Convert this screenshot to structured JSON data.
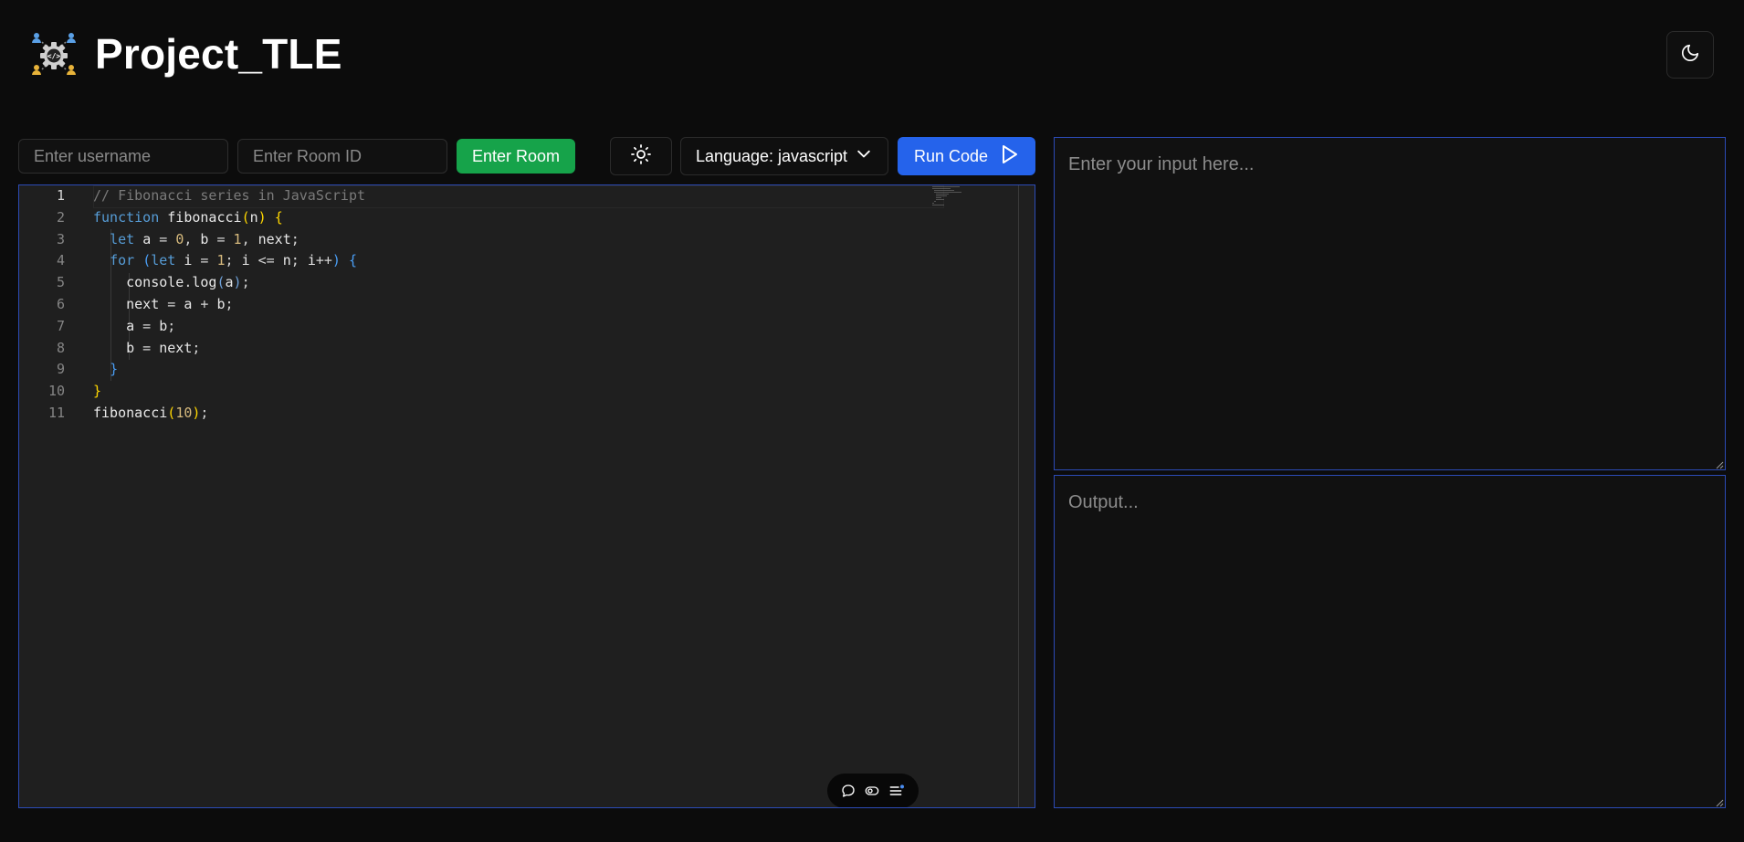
{
  "header": {
    "title": "Project_TLE",
    "logo_icon": "collaboration-gear-icon",
    "theme_icon": "moon-icon"
  },
  "toolbar": {
    "username_placeholder": "Enter username",
    "room_placeholder": "Enter Room ID",
    "enter_room_label": "Enter Room",
    "editor_theme_icon": "sun-icon",
    "language_label": "Language: javascript",
    "language_icon": "chevron-down-icon",
    "run_label": "Run Code",
    "run_icon": "play-icon"
  },
  "editor": {
    "line_numbers": [
      "1",
      "2",
      "3",
      "4",
      "5",
      "6",
      "7",
      "8",
      "9",
      "10",
      "11"
    ],
    "active_line": 1,
    "code_lines": [
      "// Fibonacci series in JavaScript",
      "function fibonacci(n) {",
      "  let a = 0, b = 1, next;",
      "  for (let i = 1; i <= n; i++) {",
      "    console.log(a);",
      "    next = a + b;",
      "    a = b;",
      "    b = next;",
      "  }",
      "}",
      "fibonacci(10);"
    ],
    "actions": [
      "comment-icon",
      "toggle-icon",
      "list-icon"
    ]
  },
  "io": {
    "input_placeholder": "Enter your input here...",
    "output_placeholder": "Output..."
  },
  "colors": {
    "background": "#0c0c0c",
    "editor_bg": "#1f1f1f",
    "accent_blue": "#2563eb",
    "accent_green": "#16a34a",
    "pane_border": "#2c4bb6"
  }
}
